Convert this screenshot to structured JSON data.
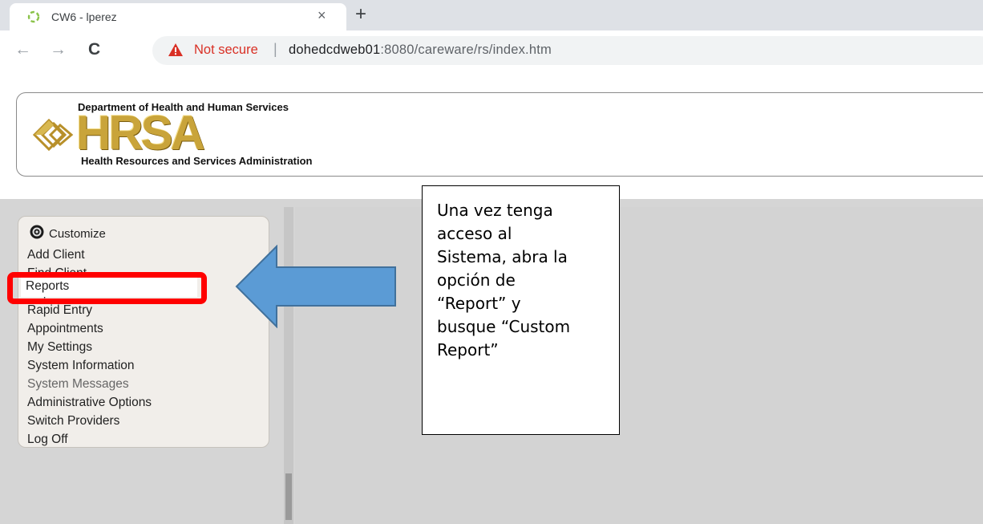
{
  "browser": {
    "tab_title": "CW6 - lperez",
    "tab_close": "×",
    "new_tab": "+",
    "back": "←",
    "forward": "→",
    "reload": "C",
    "security_label": "Not secure",
    "separator": "|",
    "url_host": "dohedcdweb01",
    "url_rest": ":8080/careware/rs/index.htm",
    "colors": {
      "tab_strip": "#dee1e6",
      "warning": "#d93025"
    }
  },
  "banner": {
    "top_text": "Department of Health and Human Services",
    "logo_text": "HRSA",
    "bottom_text": "Health Resources and Services Administration"
  },
  "menu": {
    "customize_label": "Customize",
    "items": [
      {
        "label": "Add Client"
      },
      {
        "label": "Find Client"
      },
      {
        "label": "Reports"
      },
      {
        "label": "Rapid Entry"
      },
      {
        "label": "Appointments"
      },
      {
        "label": "My Settings"
      },
      {
        "label": "System Information"
      },
      {
        "label": "System Messages"
      },
      {
        "label": "Administrative Options"
      },
      {
        "label": "Switch Providers"
      },
      {
        "label": "Log Off"
      }
    ]
  },
  "annotation": {
    "highlight_color": "#ff0000",
    "arrow_color": "#5b9bd5",
    "callout_text": "Una vez tenga\nacceso al\nSistema, abra la\nopción de\n“Report” y\nbusque  “Custom\nReport”"
  }
}
